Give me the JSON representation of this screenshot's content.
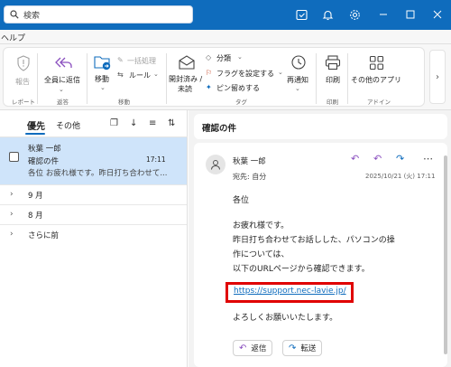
{
  "search": {
    "placeholder": "検索"
  },
  "menubar": {
    "label": "ヘルプ"
  },
  "ribbon": {
    "report_label": "報告",
    "report_group": "レポート",
    "reply_all_line1": "全員に返信",
    "respond_group": "返答",
    "move_label": "移動",
    "move_group": "移動",
    "bulk_clean_label": "一括処理",
    "rules_label": "ルール",
    "read_unread_line1": "開封済み /",
    "read_unread_line2": "未読",
    "categorize_label": "分類",
    "flag_label": "フラグを設定する",
    "pin_label": "ピン留めする",
    "tags_group": "タグ",
    "snooze_label": "再通知",
    "print_label": "印刷",
    "print_group": "印刷",
    "other_apps_label": "その他のアプリ",
    "addins_group": "アドイン"
  },
  "list": {
    "tab_focused": "優先",
    "tab_other": "その他",
    "message": {
      "sender": "秋葉 一郎",
      "subject": "確認の件",
      "preview": "各位 お疲れ様です。昨日打ち合わせて...",
      "time": "17:11"
    },
    "folders": [
      {
        "label": "9 月"
      },
      {
        "label": "8 月"
      },
      {
        "label": "さらに前"
      }
    ]
  },
  "reading": {
    "subject": "確認の件",
    "sender": "秋葉 一郎",
    "to_line": "宛先: 自分",
    "date": "2025/10/21 (火) 17:11",
    "body": [
      "各位",
      "お疲れ様です。",
      "昨日打ち合わせてお話しした、パソコンの操",
      "作については、",
      "以下のURLページから確認できます。"
    ],
    "link": "https://support.nec-lavie.jp/",
    "closing": "よろしくお願いいたします。",
    "reply_button": "返信",
    "forward_button": "転送"
  },
  "colors": {
    "accent": "#0f6cbd",
    "highlight_box": "#e00000",
    "selected_row": "#cfe4fa"
  }
}
